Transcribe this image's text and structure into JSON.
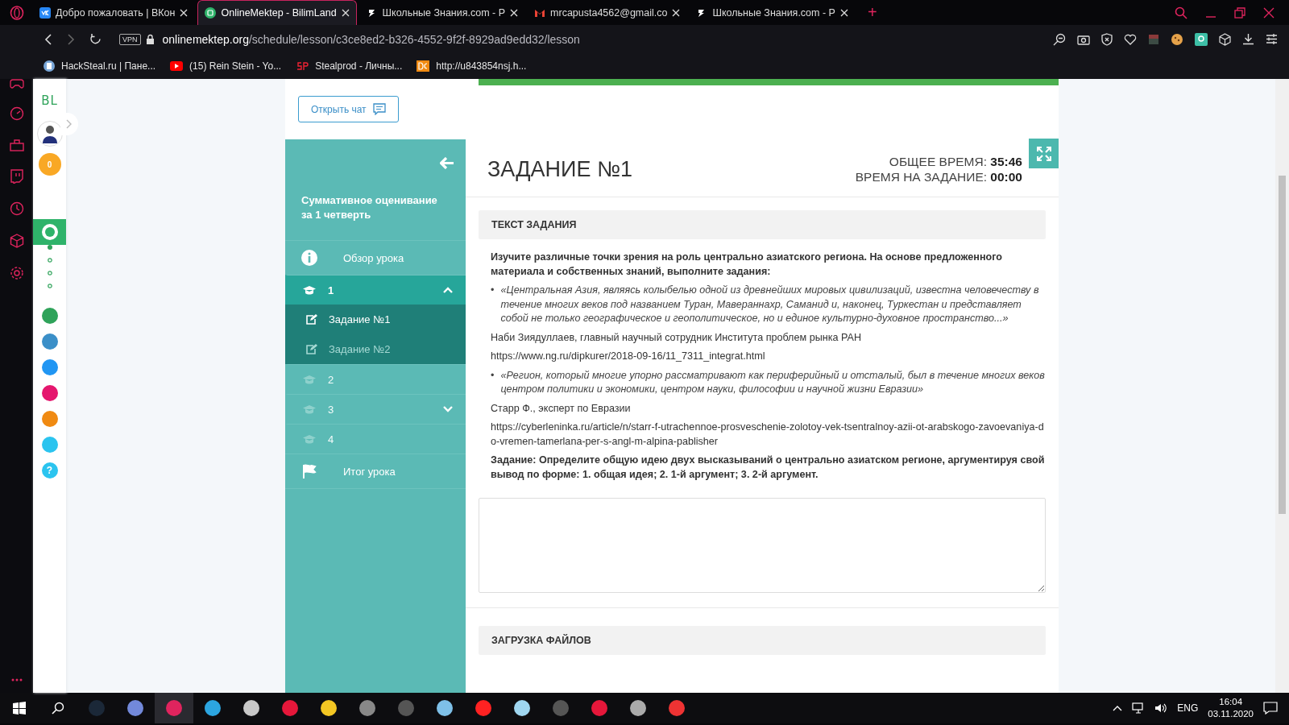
{
  "browser": {
    "tabs": [
      {
        "title": "Добро пожаловать | ВКон",
        "kind": "vk",
        "selected": false
      },
      {
        "title": "OnlineMektep - BilimLand",
        "kind": "bilim",
        "selected": true
      },
      {
        "title": "Школьные Знания.com - Р",
        "kind": "znanija",
        "selected": false
      },
      {
        "title": "mrcapusta4562@gmail.co",
        "kind": "gmail",
        "selected": false
      },
      {
        "title": "Школьные Знания.com - Р",
        "kind": "znanija",
        "selected": false
      }
    ],
    "new_tab": "+",
    "vpn": "VPN",
    "url_host": "onlinemektep.org",
    "url_path": "/schedule/lesson/c3ce8ed2-b326-4552-9f2f-8929ad9edd32/lesson",
    "bookmarks": [
      {
        "title": "HackSteal.ru | Пане...",
        "kind": "doc"
      },
      {
        "title": "(15) Rein Stein - Yo...",
        "kind": "youtube"
      },
      {
        "title": "Stealprod - Личны...",
        "kind": "sp"
      },
      {
        "title": "http://u843854nsj.h...",
        "kind": "dc"
      }
    ]
  },
  "site_sidebar": {
    "logo": "BL",
    "coins": "0",
    "apps": [
      {
        "color": "#2fb36a",
        "selected": true
      },
      {
        "color": "#2fa35a",
        "selected": false
      },
      {
        "color": "#3b8fc8",
        "selected": false
      },
      {
        "color": "#2196f3",
        "selected": false
      },
      {
        "color": "#e5176e",
        "selected": false
      },
      {
        "color": "#f08a12",
        "selected": false
      },
      {
        "color": "#2bc4ef",
        "selected": false
      }
    ],
    "help": "?"
  },
  "open_chat": "Открыть чат",
  "lesson": {
    "title": "Суммативное оценивание за 1 четверть",
    "overview": "Обзор урока",
    "sections": [
      {
        "label": "1",
        "selected": true,
        "expandable": true,
        "expanded": true,
        "tasks": [
          {
            "label": "Задание №1",
            "selected": true
          },
          {
            "label": "Задание №2",
            "selected": false
          }
        ]
      },
      {
        "label": "2",
        "selected": false,
        "expandable": false
      },
      {
        "label": "3",
        "selected": false,
        "expandable": true,
        "expanded": false
      },
      {
        "label": "4",
        "selected": false,
        "expandable": false
      }
    ],
    "summary": "Итог урока"
  },
  "task": {
    "progress": {
      "level": 1
    },
    "title": "ЗАДАНИЕ №1",
    "total_label": "ОБЩЕЕ ВРЕМЯ:",
    "total_value": "35:46",
    "task_label": "ВРЕМЯ НА ЗАДАНИЕ:",
    "task_value": "00:00",
    "text_header": "ТЕКСТ ЗАДАНИЯ",
    "blocks": [
      {
        "kind": "bold",
        "text": "Изучите различные точки зрения на роль центрально азиатского региона. На основе предложенного материала и собственных знаний, выполните задания:"
      },
      {
        "kind": "quote",
        "bullet": "•",
        "text": "«Центральная Азия, являясь колыбелью одной из древнейших мировых цивилизаций, известна человечеству в течение многих веков под названием Туран, Мавераннахр, Саманид и, наконец, Туркестан и представляет собой не только географическое и геополитическое, но и единое культурно-духовное пространство...»"
      },
      {
        "kind": "text",
        "text": "Наби Зиядуллаев, главный научный сотрудник Института проблем рынка РАН"
      },
      {
        "kind": "text",
        "text": "https://www.ng.ru/dipkurer/2018-09-16/11_7311_integrat.html"
      },
      {
        "kind": "quote",
        "bullet": "•",
        "text": "«Регион, который многие упорно рассматривают как периферийный и отсталый, был в течение многих веков центром политики и экономики, центром науки, философии и научной жизни Евразии»"
      },
      {
        "kind": "text",
        "text": "Старр Ф., эксперт по Евразии"
      },
      {
        "kind": "text",
        "text": "https://cyberleninka.ru/article/n/starr-f-utrachennoe-prosveschenie-zolotoy-vek-tsentralnoy-azii-ot-arabskogo-zavoevaniya-do-vremen-tamerlana-per-s-angl-m-alpina-pablisher"
      },
      {
        "kind": "bold",
        "text": "Задание: Определите общую идею двух высказываний о центрально азиатском регионе, аргументируя свой вывод по форме: 1. общая идея; 2. 1-й аргумент; 3. 2-й аргумент."
      }
    ],
    "upload_header": "ЗАГРУЗКА ФАЙЛОВ"
  },
  "taskbar": {
    "lang": "ENG",
    "time": "16:04",
    "date": "03.11.2020"
  }
}
